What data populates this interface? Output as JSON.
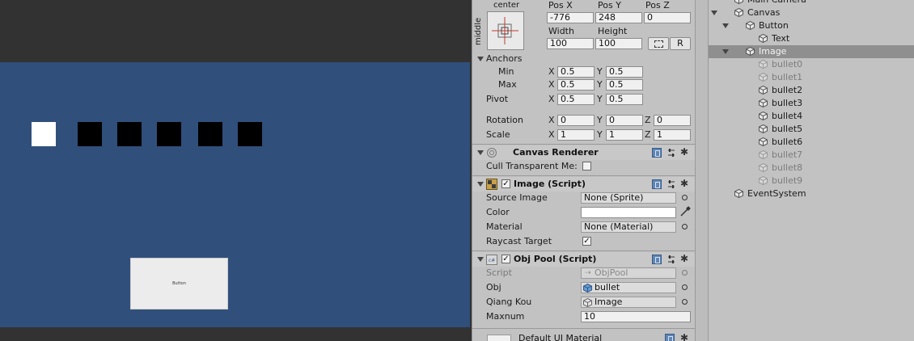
{
  "game_view": {
    "button_text": "Button"
  },
  "inspector": {
    "rect_transform": {
      "anchor_preset": {
        "horizontal": "center",
        "vertical": "middle"
      },
      "pos_x_label": "Pos X",
      "pos_y_label": "Pos Y",
      "pos_z_label": "Pos Z",
      "pos_x": "-776",
      "pos_y": "248",
      "pos_z": "0",
      "width_label": "Width",
      "height_label": "Height",
      "width": "100",
      "height": "100",
      "raw_button": "R",
      "anchors_label": "Anchors",
      "min_label": "Min",
      "max_label": "Max",
      "pivot_label": "Pivot",
      "anchor_min_x": "0.5",
      "anchor_min_y": "0.5",
      "anchor_max_x": "0.5",
      "anchor_max_y": "0.5",
      "pivot_x": "0.5",
      "pivot_y": "0.5",
      "rotation_label": "Rotation",
      "scale_label": "Scale",
      "rotation_x": "0",
      "rotation_y": "0",
      "rotation_z": "0",
      "scale_x": "1",
      "scale_y": "1",
      "scale_z": "1",
      "axis_x": "X",
      "axis_y": "Y",
      "axis_z": "Z"
    },
    "canvas_renderer": {
      "title": "Canvas Renderer",
      "cull_label": "Cull Transparent Me:"
    },
    "image_script": {
      "title": "Image (Script)",
      "source_image_label": "Source Image",
      "source_image_value": "None (Sprite)",
      "color_label": "Color",
      "color_value": "#ffffff",
      "material_label": "Material",
      "material_value": "None (Material)",
      "raycast_label": "Raycast Target"
    },
    "obj_pool": {
      "title": "Obj Pool (Script)",
      "script_label": "Script",
      "script_value": "ObjPool",
      "obj_label": "Obj",
      "obj_value": "bullet",
      "qiang_kou_label": "Qiang Kou",
      "qiang_kou_value": "Image",
      "maxnum_label": "Maxnum",
      "maxnum_value": "10"
    },
    "material_footer": {
      "title": "Default UI Material"
    }
  },
  "hierarchy": {
    "items": [
      {
        "name": "Main Camera"
      },
      {
        "name": "Canvas"
      },
      {
        "name": "Button"
      },
      {
        "name": "Text"
      },
      {
        "name": "Image"
      },
      {
        "name": "bullet0"
      },
      {
        "name": "bullet1"
      },
      {
        "name": "bullet2"
      },
      {
        "name": "bullet3"
      },
      {
        "name": "bullet4"
      },
      {
        "name": "bullet5"
      },
      {
        "name": "bullet6"
      },
      {
        "name": "bullet7"
      },
      {
        "name": "bullet8"
      },
      {
        "name": "bullet9"
      },
      {
        "name": "EventSystem"
      }
    ]
  }
}
